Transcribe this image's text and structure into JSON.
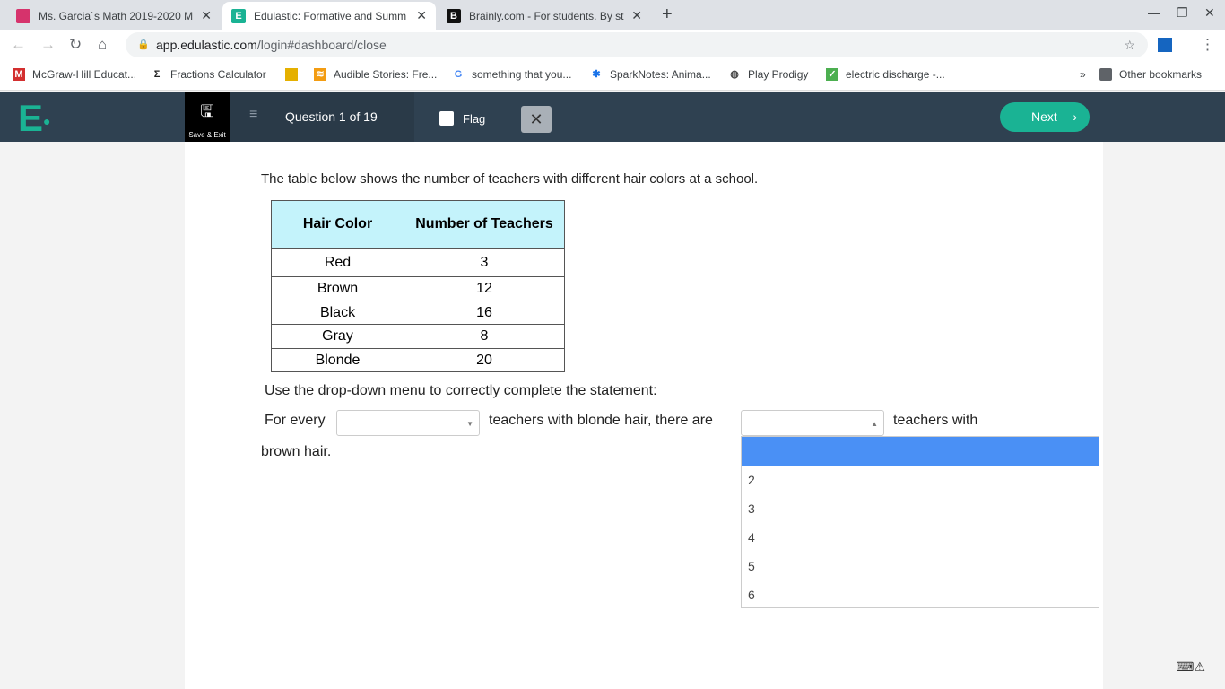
{
  "browser": {
    "tabs": [
      {
        "title": "Ms. Garcia`s Math 2019-2020 M",
        "color": "#d6336c",
        "letter": "▪"
      },
      {
        "title": "Edulastic: Formative and Summ",
        "color": "#1ab394",
        "letter": "E"
      },
      {
        "title": "Brainly.com - For students. By st",
        "color": "#111",
        "letter": "B"
      }
    ],
    "url_host": "app.edulastic.com",
    "url_path": "/login#dashboard/close",
    "bookmarks": [
      {
        "label": "McGraw-Hill Educat...",
        "color": "#d32f2f",
        "icon": "M"
      },
      {
        "label": "Fractions Calculator",
        "color": "#222",
        "icon": "Σ"
      },
      {
        "label": "",
        "color": "#3b9a3b",
        "icon": "▪"
      },
      {
        "label": "Audible Stories: Fre...",
        "color": "#f39c12",
        "icon": "≋"
      },
      {
        "label": "something that you...",
        "color": "#4285f4",
        "icon": "G"
      },
      {
        "label": "SparkNotes: Anima...",
        "color": "#1a73e8",
        "icon": "✱"
      },
      {
        "label": "Play Prodigy",
        "color": "#444",
        "icon": "◍"
      },
      {
        "label": "electric discharge -...",
        "color": "#4caf50",
        "icon": "✓"
      }
    ],
    "other_bookmarks": "Other bookmarks"
  },
  "toolbar": {
    "save_label": "Save & Exit",
    "question": "Question 1 of 19",
    "flag": "Flag",
    "next": "Next"
  },
  "question": {
    "prompt": "The table below shows the number of teachers with different hair colors at a school.",
    "table": {
      "headers": [
        "Hair Color",
        "Number of Teachers"
      ],
      "rows": [
        [
          "Red",
          "3"
        ],
        [
          "Brown",
          "12"
        ],
        [
          "Black",
          "16"
        ],
        [
          "Gray",
          "8"
        ],
        [
          "Blonde",
          "20"
        ]
      ]
    },
    "instruction": "Use the drop-down menu to correctly complete the statement:",
    "part1": "For every",
    "part2": "teachers with blonde hair, there are",
    "part3": "teachers with",
    "part4": "brown hair.",
    "options": [
      "",
      "2",
      "3",
      "4",
      "5",
      "6"
    ]
  }
}
